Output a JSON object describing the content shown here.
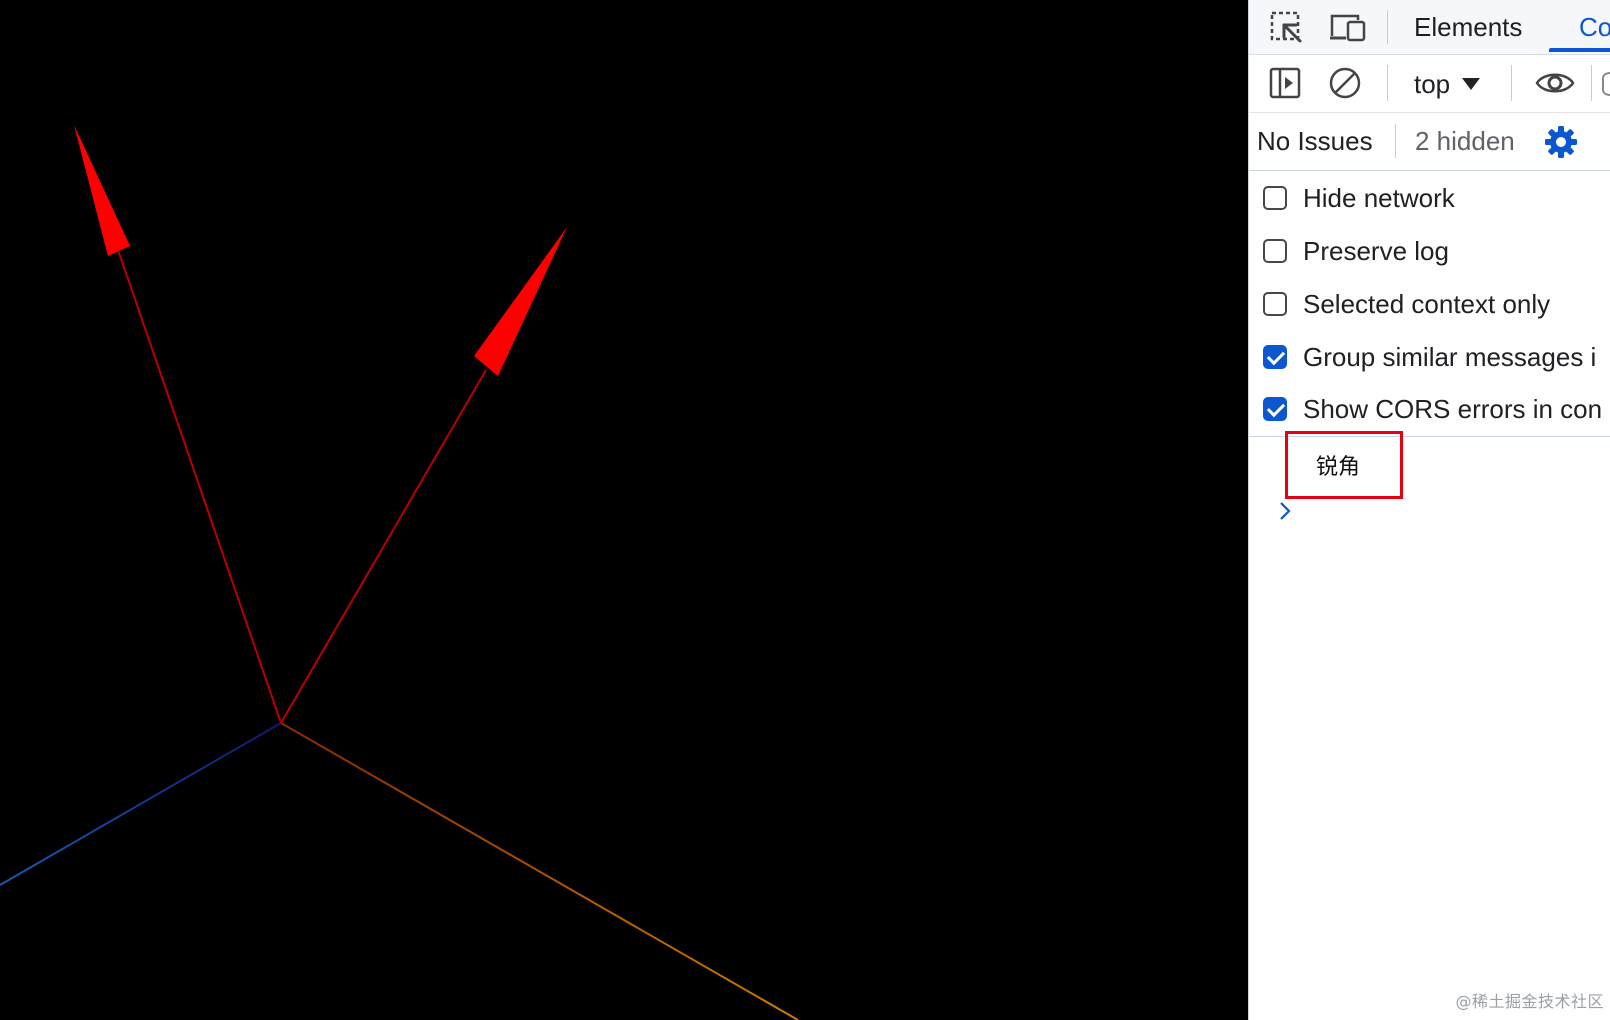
{
  "devtools": {
    "tabs": {
      "elements_label": "Elements",
      "console_label": "Co"
    },
    "toolbar": {
      "context_value": "top"
    },
    "issues": {
      "no_issues_label": "No Issues",
      "hidden_label": "2 hidden"
    },
    "settings": [
      {
        "label": "Hide network",
        "checked": false
      },
      {
        "label": "Preserve log",
        "checked": false
      },
      {
        "label": "Selected context only",
        "checked": false
      },
      {
        "label": "Group similar messages i",
        "checked": true
      },
      {
        "label": "Show CORS errors in con",
        "checked": true
      }
    ],
    "console": {
      "message": "锐角"
    }
  },
  "watermark": "@稀土掘金技术社区",
  "colors": {
    "accent": "#0b57d0",
    "highlight_box": "#e60012",
    "arrow": "#ff0000",
    "axis_y": "#7ec800",
    "axis_x": "#d06000",
    "axis_z": "#1e4fb8"
  }
}
